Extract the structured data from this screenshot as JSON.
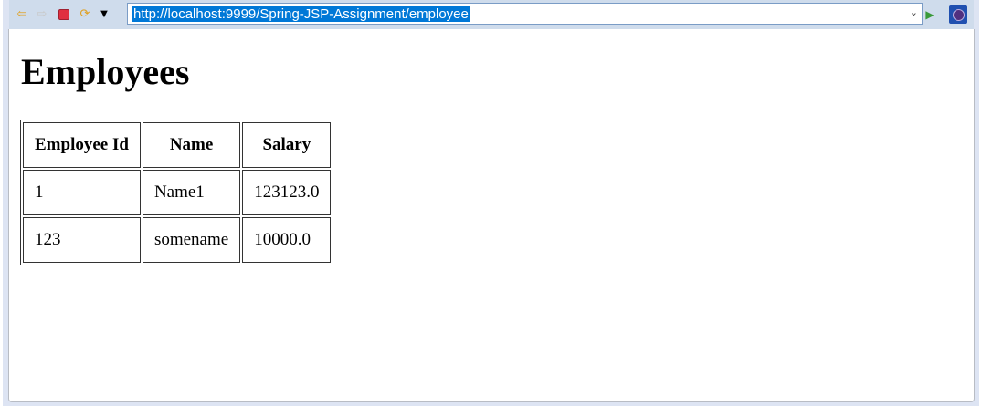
{
  "browser": {
    "url": "http://localhost:9999/Spring-JSP-Assignment/employee",
    "icons": [
      "back-icon",
      "forward-icon",
      "stop-icon",
      "refresh-icon",
      "menu-dropdown-icon",
      "go-icon",
      "eclipse-browser-icon"
    ]
  },
  "page": {
    "title": "Employees",
    "table": {
      "headers": [
        "Employee Id",
        "Name",
        "Salary"
      ],
      "rows": [
        [
          "1",
          "Name1",
          "123123.0"
        ],
        [
          "123",
          "somename",
          "10000.0"
        ]
      ]
    }
  }
}
